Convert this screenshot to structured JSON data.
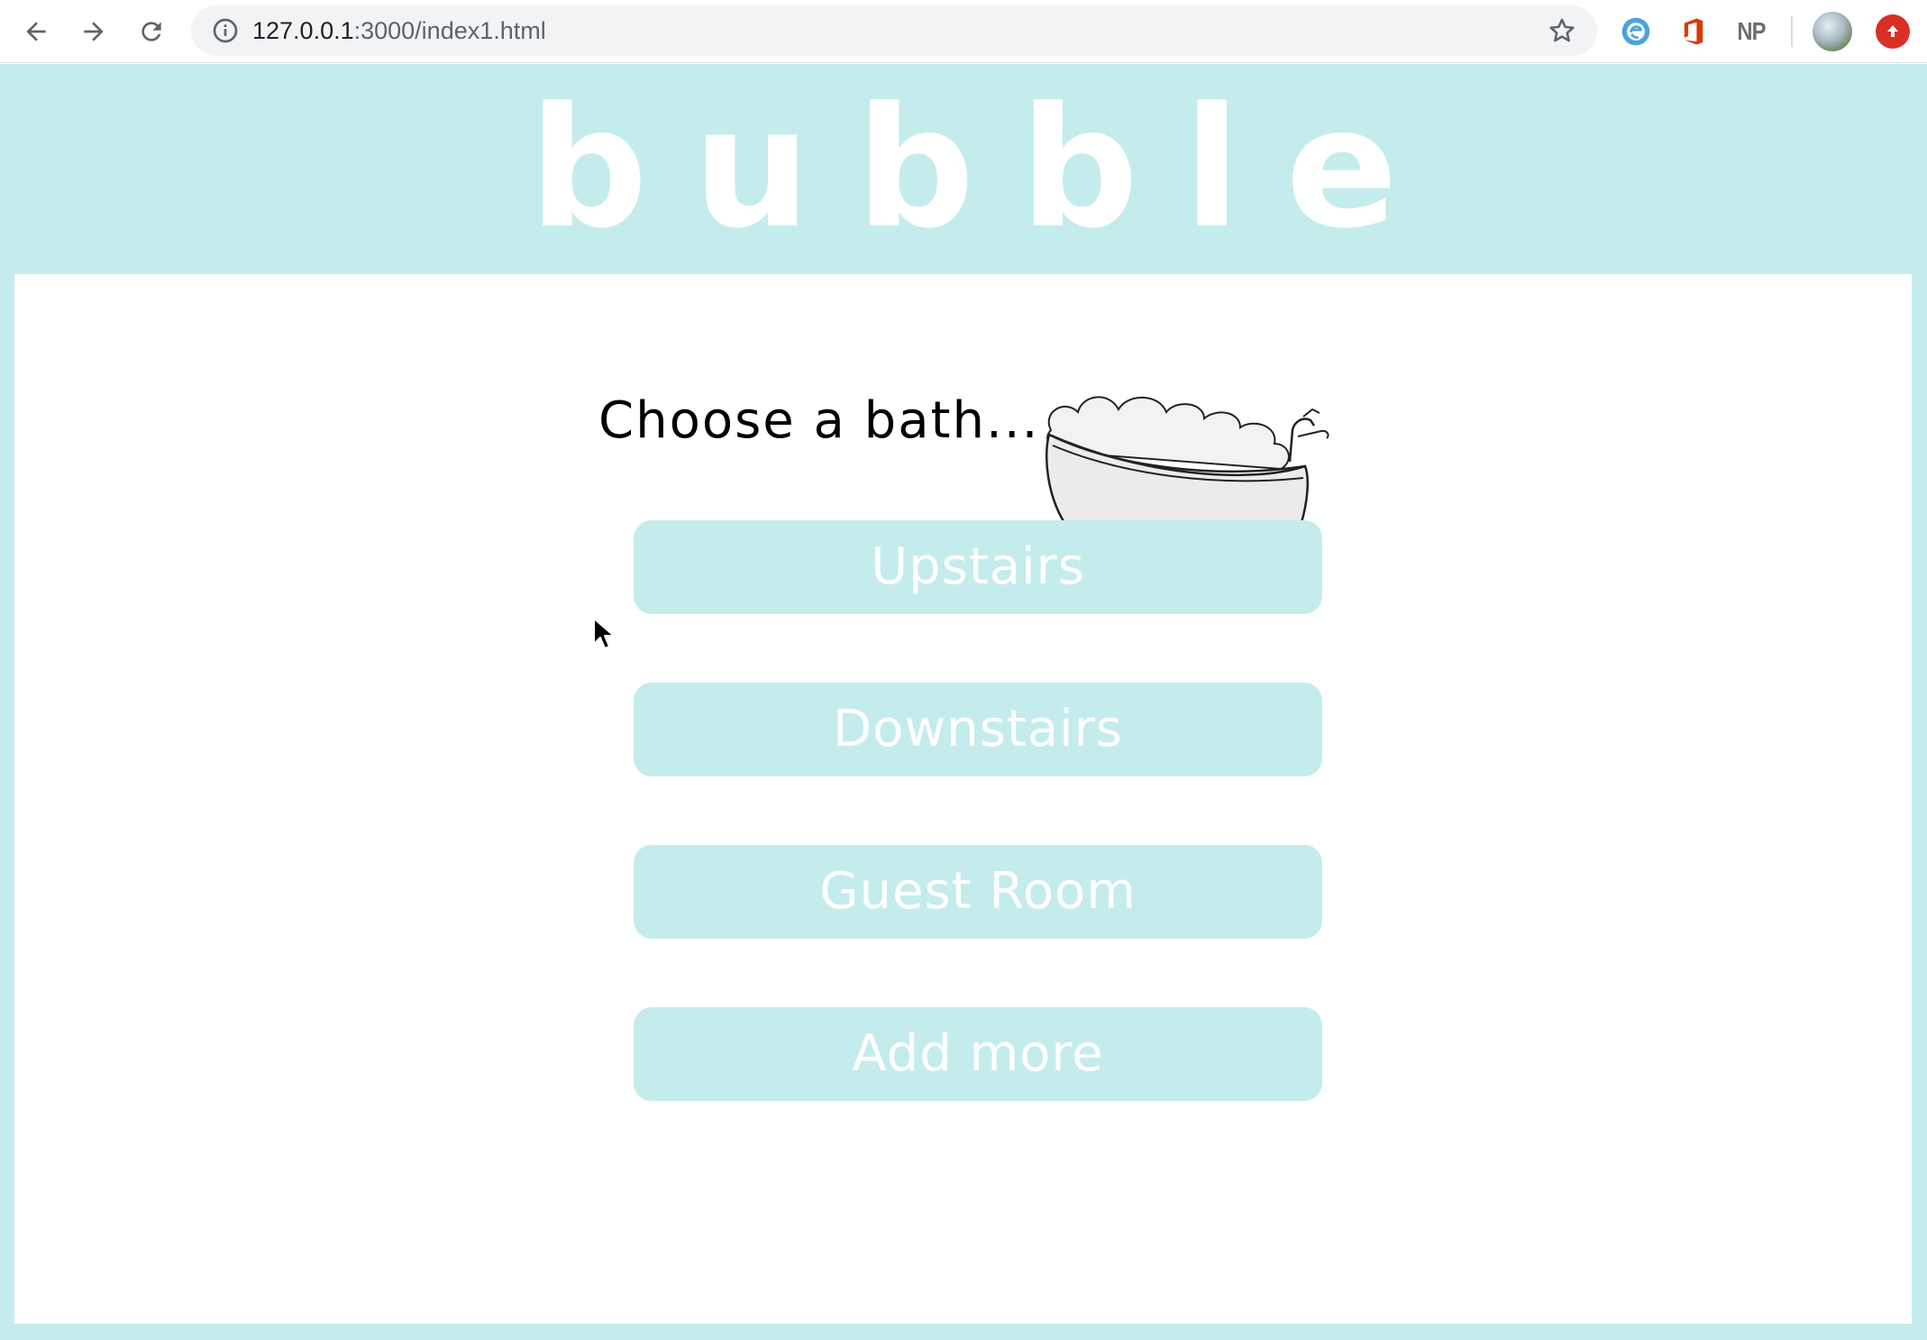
{
  "browser": {
    "url_host": "127.0.0.1",
    "url_path": ":3000/index1.html",
    "icons": {
      "back": "arrow-left-icon",
      "forward": "arrow-right-icon",
      "reload": "reload-icon",
      "site_info": "info-icon",
      "bookmark": "star-icon"
    },
    "extensions": [
      {
        "name": "edge-extension-icon"
      },
      {
        "name": "office-extension-icon"
      },
      {
        "name": "np-extension",
        "label": "NP"
      }
    ]
  },
  "brand": {
    "letters": [
      "b",
      "u",
      "b",
      "b",
      "l",
      "e"
    ]
  },
  "main": {
    "heading": "Choose a bath...",
    "image": "bathtub-illustration",
    "choices": [
      {
        "label": "Upstairs"
      },
      {
        "label": "Downstairs"
      },
      {
        "label": "Guest Room"
      },
      {
        "label": "Add more"
      }
    ]
  },
  "colors": {
    "accent": "#c5ecec",
    "text_on_accent": "#ffffff",
    "heading": "#000000"
  }
}
